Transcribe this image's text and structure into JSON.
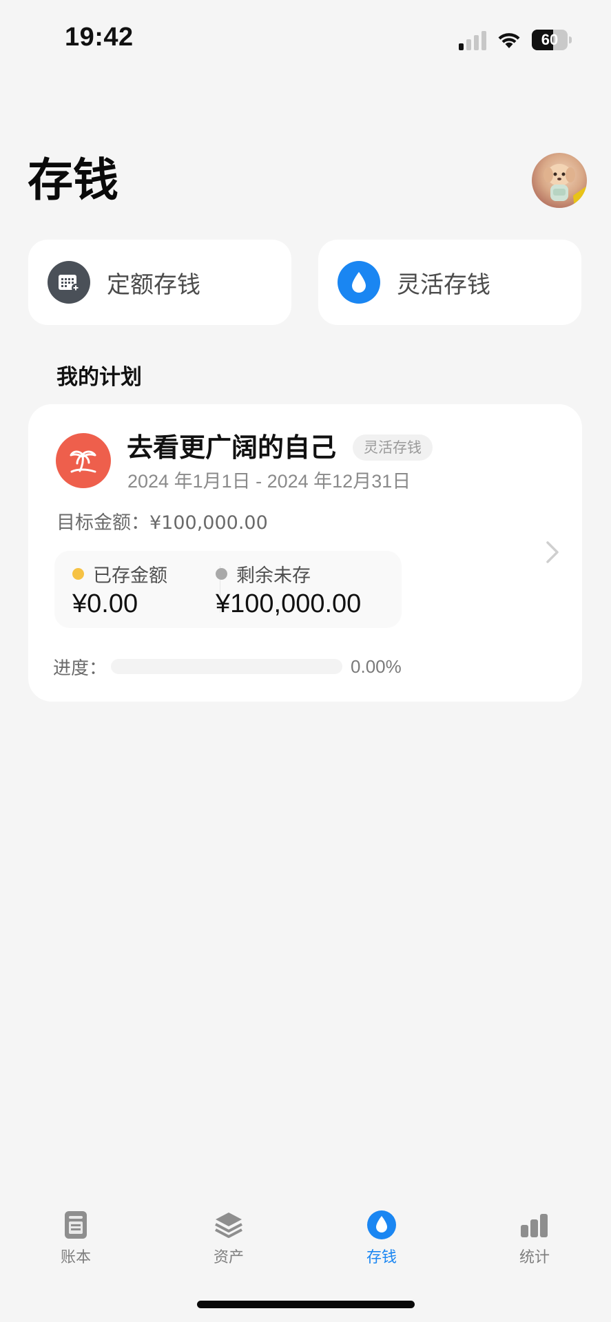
{
  "status_bar": {
    "time": "19:42",
    "battery_level": "60",
    "battery_fraction": 0.6,
    "signal_bars_active": 1,
    "signal_bars_total": 4
  },
  "header": {
    "title": "存钱"
  },
  "actions": {
    "fixed_label": "定额存钱",
    "flexible_label": "灵活存钱"
  },
  "section": {
    "my_plans": "我的计划"
  },
  "plan": {
    "name": "去看更广阔的自己",
    "tag": "灵活存钱",
    "dates": "2024 年1月1日 - 2024 年12月31日",
    "target_label": "目标金额：",
    "target_amount": "¥100,000.00",
    "saved_label": "已存金额",
    "saved_amount": "¥0.00",
    "remaining_label": "剩余未存",
    "remaining_amount": "¥100,000.00",
    "progress_label": "进度：",
    "progress_value": "0.00%",
    "progress_fraction": 0.0
  },
  "tabs": [
    {
      "label": "账本",
      "icon": "ledger-icon",
      "active": false
    },
    {
      "label": "资产",
      "icon": "layers-icon",
      "active": false
    },
    {
      "label": "存钱",
      "icon": "drop-icon",
      "active": true
    },
    {
      "label": "统计",
      "icon": "bar-chart-icon",
      "active": false
    }
  ],
  "colors": {
    "accent": "#1a86f2",
    "plan_icon_bg": "#ee5f4c",
    "saved_dot": "#f6c244",
    "remaining_dot": "#a9a9a9"
  }
}
